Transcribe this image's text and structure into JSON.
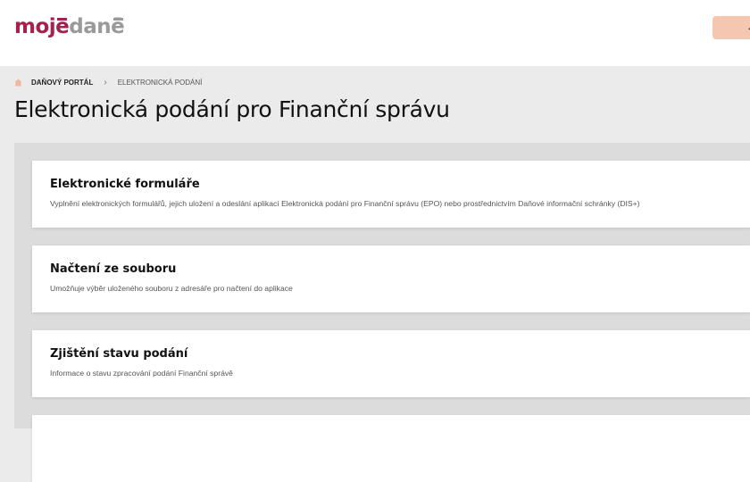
{
  "header": {
    "logo_left": "moje",
    "logo_right": "danē",
    "button_label": "←"
  },
  "breadcrumb": {
    "items": [
      {
        "label": "DAŇOVÝ PORTÁL"
      },
      {
        "label": "ELEKTRONICKÁ PODÁNÍ"
      }
    ],
    "separator": "›"
  },
  "page": {
    "title": "Elektronická podání pro Finanční správu"
  },
  "cards": [
    {
      "title": "Elektronické formuláře",
      "description": "Vyplnění elektronických formulářů, jejich uložení a odeslání aplikací Elektronická podání pro Finanční správu (EPO) nebo prostřednictvím Daňové informační schránky (DIS+)"
    },
    {
      "title": "Načtení ze souboru",
      "description": "Umožňuje výběr uloženého souboru z adresáře pro načtení do aplikace"
    },
    {
      "title": "Zjištění stavu podání",
      "description": "Informace o stavu zpracování podání Finanční správě"
    },
    {
      "title": "",
      "description": ""
    }
  ],
  "colors": {
    "brand": "#a3214c",
    "logo_gray": "#9a9a9a",
    "button_bg": "#f5c7b0",
    "home_icon": "#f3b8a0"
  },
  "icons": {
    "home": "home-icon"
  }
}
